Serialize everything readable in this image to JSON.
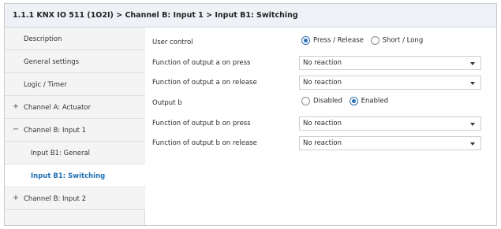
{
  "breadcrumb": "1.1.1 KNX IO 511 (1O2I) > Channel B: Input 1 > Input B1: Switching",
  "sidebar": {
    "items": [
      {
        "label": "Description",
        "sign": ""
      },
      {
        "label": "General settings",
        "sign": ""
      },
      {
        "label": "Logic / Timer",
        "sign": ""
      },
      {
        "label": "Channel A: Actuator",
        "sign": "+"
      },
      {
        "label": "Channel B: Input 1",
        "sign": "−"
      },
      {
        "label": "Input B1: General",
        "sign": ""
      },
      {
        "label": "Input B1: Switching",
        "sign": ""
      },
      {
        "label": "Channel B: Input 2",
        "sign": "+"
      }
    ],
    "active_index": 6
  },
  "params": {
    "user_control": {
      "label": "User control",
      "options": [
        "Press / Release",
        "Short / Long"
      ],
      "selected": "Press / Release"
    },
    "output_a_press": {
      "label": "Function of output a on press",
      "value": "No reaction"
    },
    "output_a_release": {
      "label": "Function of output a on release",
      "value": "No reaction"
    },
    "output_b": {
      "label": "Output b",
      "options": [
        "Disabled",
        "Enabled"
      ],
      "selected": "Enabled"
    },
    "output_b_press": {
      "label": "Function of output b on press",
      "value": "No reaction"
    },
    "output_b_release": {
      "label": "Function of output b on release",
      "value": "No reaction"
    }
  },
  "colors": {
    "accent": "#1f6fb5",
    "titlebar_bg": "#eef1f5",
    "sidebar_bg": "#f4f4f4"
  }
}
